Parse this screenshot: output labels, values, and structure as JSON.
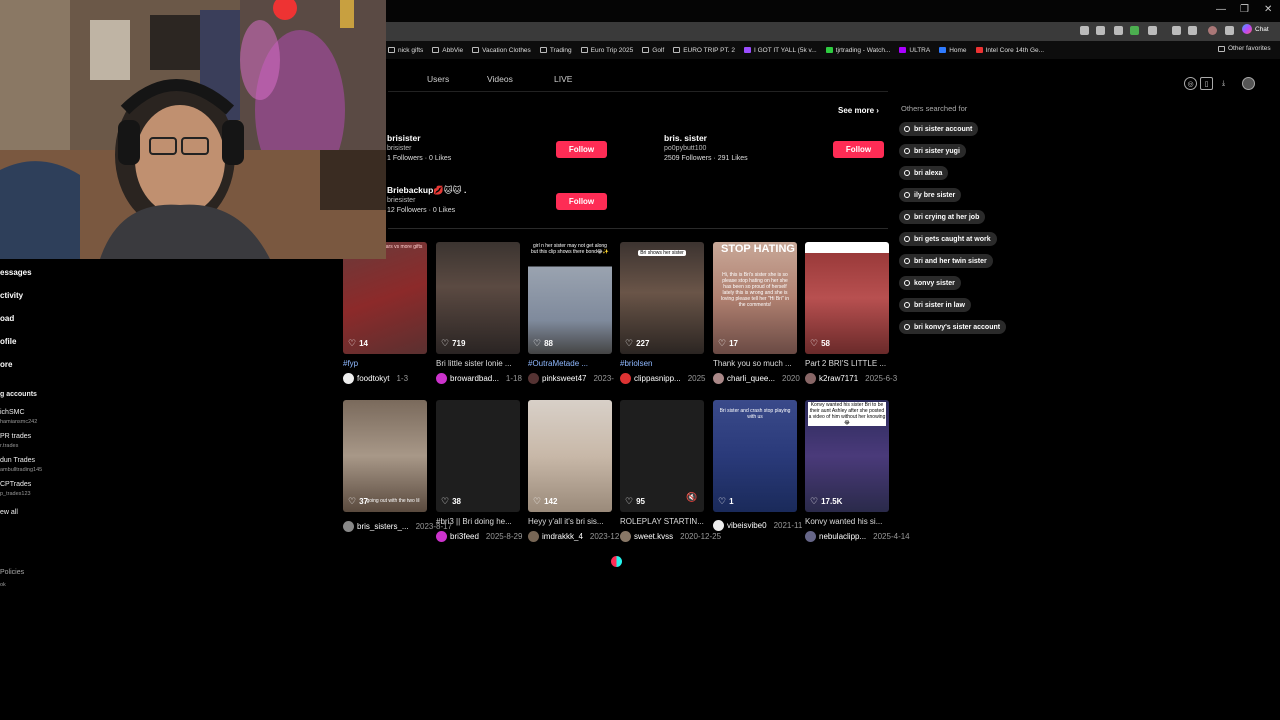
{
  "bookmarks": [
    "nick gifts",
    "AbbVie",
    "Vacation Clothes",
    "Trading",
    "Euro Trip 2025",
    "Golf",
    "EURO TRIP PT. 2",
    "I GOT IT YALL (5k v...",
    "tjrtrading - Watch...",
    "ULTRA",
    "Home",
    "Intel Core 14th Ge..."
  ],
  "other_favorites": "Other favorites",
  "chat_label": "Chat",
  "tabs": [
    "Users",
    "Videos",
    "LIVE"
  ],
  "see_more": "See more",
  "users": [
    {
      "name": "brisister",
      "handle": "brisister",
      "followers": "1 Followers",
      "likes": "0 Likes",
      "follow": "Follow"
    },
    {
      "name": "bris. sister",
      "handle": "po0pybutt100",
      "followers": "2509 Followers",
      "likes": "291 Likes",
      "follow": "Follow"
    },
    {
      "name": "Briebackup💋🐱🐱 .",
      "handle": "briesister",
      "followers": "12 Followers",
      "likes": "0 Likes",
      "follow": "Follow"
    }
  ],
  "others_title": "Others searched for",
  "suggestions": [
    "bri sister account",
    "bri sister yugi",
    "bri alexa",
    "ily bre sister",
    "bri crying at her job",
    "bri gets caught at work",
    "bri and her twin sister",
    "konvy sister",
    "bri sister in law",
    "bri konvy's sister account"
  ],
  "sidebar": {
    "items": [
      "essages",
      "ctivity",
      "oad",
      "ofile",
      "ore"
    ],
    "following_header": "g accounts",
    "accounts": [
      {
        "name": "ichSMC",
        "handle": "hamiansmc242"
      },
      {
        "name": "PR trades",
        "handle": "r.trades"
      },
      {
        "name": "dun Trades",
        "handle": "ambulltrading145"
      },
      {
        "name": "CPTrades",
        "handle": "p_trades123"
      }
    ],
    "see_all": "ew all",
    "footer_a": "Policies",
    "footer_b": "ok"
  },
  "videos_row1": [
    {
      "likes": "14",
      "caption": "#fyp",
      "tag": true,
      "author": "foodtokyt",
      "date": "1-3"
    },
    {
      "likes": "719",
      "caption": "Bri little sister lonie ...",
      "tag": false,
      "author": "browardbad...",
      "date": "1-18"
    },
    {
      "likes": "88",
      "caption": "#OutraMetade ...",
      "tag": true,
      "author": "pinksweet47",
      "date": "2023-"
    },
    {
      "likes": "227",
      "caption": "#briolsen",
      "tag": true,
      "author": "clippasnipp...",
      "date": "2025"
    },
    {
      "likes": "17",
      "caption": "Thank you so much ...",
      "tag": false,
      "author": "charli_quee...",
      "date": "2020"
    },
    {
      "likes": "58",
      "caption": "Part 2 BRI'S LITTLE ...",
      "tag": false,
      "author": "k2raw7171",
      "date": "2025-6-3"
    }
  ],
  "videos_row2": [
    {
      "likes": "37",
      "caption": "",
      "author": "bris_sisters_...",
      "date": "2023-8-17"
    },
    {
      "likes": "38",
      "caption": "#bri3 || Bri doing he...",
      "author": "bri3feed",
      "date": "2025-8-29"
    },
    {
      "likes": "142",
      "caption": "Heyy y'all it's bri sis...",
      "author": "imdrakkk_4",
      "date": "2023-12"
    },
    {
      "likes": "95",
      "caption": "ROLEPLAY STARTIN...",
      "author": "sweet.kvss",
      "date": "2020-12-25"
    },
    {
      "likes": "1",
      "caption": "",
      "author": "vibeisvibe0",
      "date": "2021-11"
    },
    {
      "likes": "17.5K",
      "caption": "Konvy wanted his si...",
      "author": "nebulaclipp...",
      "date": "2025-4-14"
    }
  ],
  "thumb_overlays": {
    "t3": "girl n her sister may not get along but this clip shows there bond😂✨",
    "t4": "Bri shows her sister",
    "t5": "STOP HATING",
    "t5b": "Hi, this is Bri's sister she is so please stop hating on her she has been so proud of herself lately this is wrong and she is loving please tell her \"Hi Bri\" in the comments!",
    "r2t1": "going out with the two lil",
    "r2t5": "Bri sister and crash stop playing with us",
    "r2t6": "Konvy wanted his sister Bri to be their aunt Ashley after she posted a video of him without her knowing😂",
    "t1": "I'm flipping this stars vs more gifts"
  }
}
